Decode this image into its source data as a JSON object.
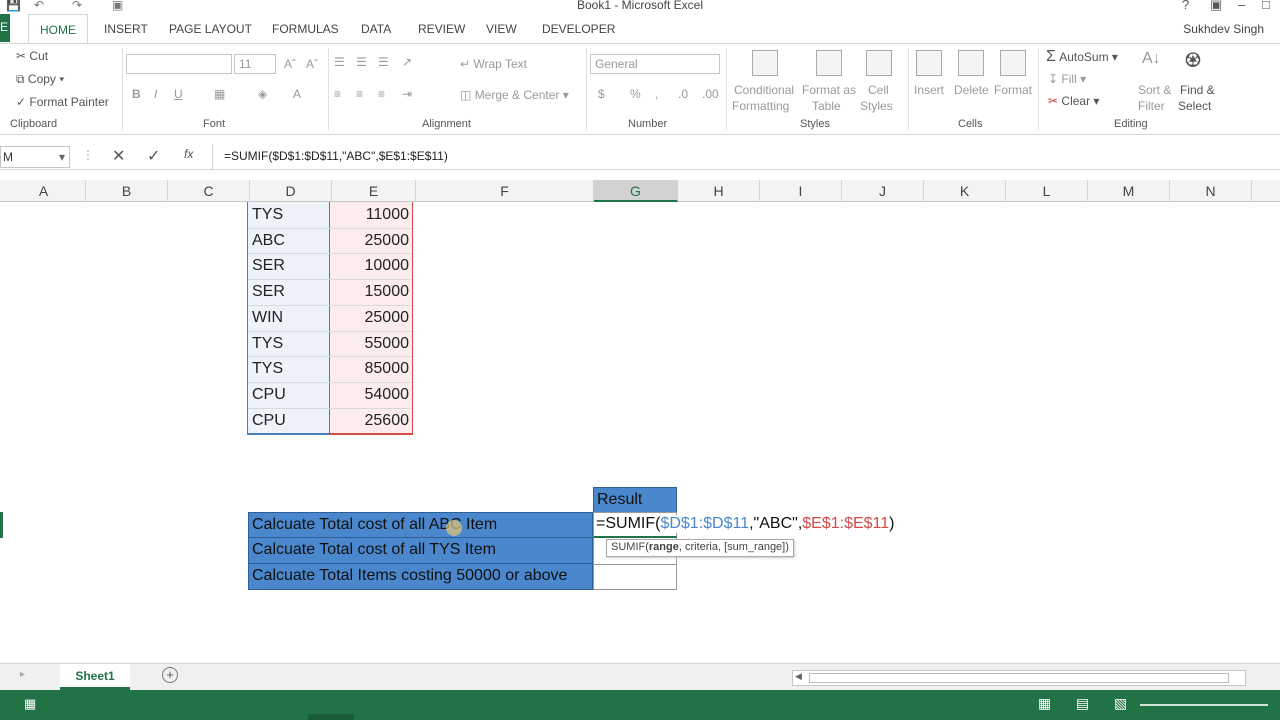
{
  "window": {
    "title": "Book1 - Microsoft Excel",
    "user": "Sukhdev Singh"
  },
  "tabs": {
    "file": "E",
    "home": "HOME",
    "insert": "INSERT",
    "page_layout": "PAGE LAYOUT",
    "formulas": "FORMULAS",
    "data": "DATA",
    "review": "REVIEW",
    "view": "VIEW",
    "developer": "DEVELOPER"
  },
  "ribbon": {
    "clipboard": {
      "cut": "Cut",
      "copy": "Copy",
      "format_painter": "Format Painter",
      "label": "Clipboard"
    },
    "font": {
      "size": "11",
      "label": "Font"
    },
    "alignment": {
      "wrap_text": "Wrap Text",
      "merge_center": "Merge & Center",
      "label": "Alignment"
    },
    "number": {
      "format": "General",
      "label": "Number"
    },
    "styles": {
      "conditional_1": "Conditional",
      "conditional_2": "Formatting",
      "format_table_1": "Format as",
      "format_table_2": "Table",
      "cell_styles_1": "Cell",
      "cell_styles_2": "Styles",
      "label": "Styles"
    },
    "cells": {
      "insert": "Insert",
      "delete": "Delete",
      "format": "Format",
      "label": "Cells"
    },
    "editing": {
      "autosum": "AutoSum",
      "fill": "Fill",
      "clear": "Clear",
      "sort_1": "Sort &",
      "sort_2": "Filter",
      "find_1": "Find &",
      "find_2": "Select",
      "label": "Editing"
    }
  },
  "formula_bar": {
    "name_box": "M",
    "formula": "=SUMIF($D$1:$D$11,\"ABC\",$E$1:$E$11)"
  },
  "columns": [
    "A",
    "B",
    "C",
    "D",
    "E",
    "F",
    "G",
    "H",
    "I",
    "J",
    "K",
    "L",
    "M",
    "N"
  ],
  "table": {
    "items": [
      "TYS",
      "ABC",
      "SER",
      "SER",
      "WIN",
      "TYS",
      "TYS",
      "CPU",
      "CPU"
    ],
    "costs": [
      "11000",
      "25000",
      "10000",
      "15000",
      "25000",
      "55000",
      "85000",
      "54000",
      "25600"
    ]
  },
  "questions": {
    "result_header": "Result",
    "q1": "Calcuate Total cost of all ABC Item",
    "q2": "Calcuate Total cost of all TYS Item",
    "q3": "Calcuate Total Items costing 50000 or above",
    "editing_formula_prefix": "=SUMIF(",
    "editing_range1": "$D$1:$D$11",
    "editing_criteria": ",\"ABC\",",
    "editing_range2": "$E$1:$E$11",
    "editing_close": ")",
    "tooltip_fn": "SUMIF(",
    "tooltip_arg1": "range",
    "tooltip_rest": ", criteria, [sum_range])"
  },
  "sheet_tabs": {
    "active": "Sheet1"
  }
}
